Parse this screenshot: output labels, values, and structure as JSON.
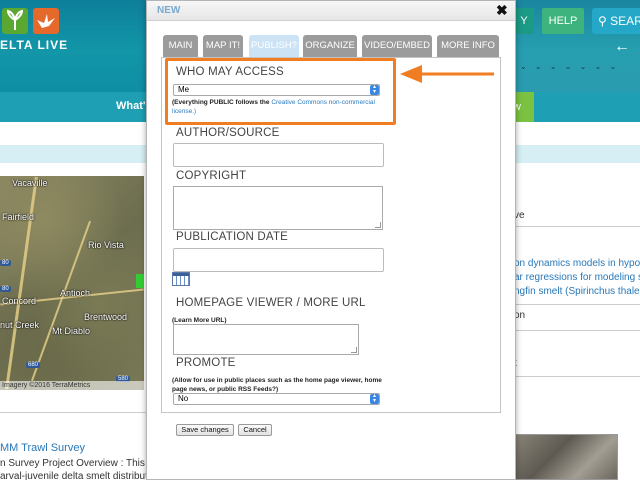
{
  "background": {
    "logo_text": "ELTA LIVE",
    "header_buttons": {
      "y_label": "Y",
      "help_label": "HELP",
      "search_label": "SEAR"
    },
    "back_arrow_glyph": "←",
    "nav_whats": "What's",
    "nav_green_label": "w",
    "map": {
      "labels": [
        "Vacaville",
        "Fairfield",
        "Rio Vista",
        "Concord",
        "Antioch",
        "Brentwood",
        "nut Creek",
        "Mt Diablo"
      ],
      "shields": [
        "80",
        "80",
        "680",
        "580"
      ],
      "credit": "Imagery ©2016 TerraMetrics"
    },
    "right_snippets": [
      "ve",
      "on dynamics models in hypothe",
      "ar regressions for modeling su",
      "ngfin smelt (Spirinchus thaleic",
      "on",
      "t"
    ],
    "bottom": {
      "link": "MM Trawl Survey",
      "line1": "n Survey Project Overview : This",
      "line2": "arval-juvenile delta smelt distributi"
    }
  },
  "modal": {
    "title": "NEW",
    "close_glyph": "✖",
    "tabs": [
      "MAIN",
      "MAP IT!",
      "PUBLISH?",
      "ORGANIZE",
      "VIDEO/EMBED",
      "MORE INFO"
    ],
    "active_tab": "PUBLISH?",
    "who_may_access": {
      "label": "WHO MAY ACCESS",
      "value": "Me",
      "hint_prefix": "(Everything PUBLIC follows the ",
      "hint_link": "Creative Commons non-commercial",
      "hint_suffix": "license.)"
    },
    "author_label": "AUTHOR/SOURCE",
    "copyright_label": "COPYRIGHT",
    "publication_date_label": "PUBLICATION DATE",
    "homepage_label": "HOMEPAGE VIEWER / MORE URL",
    "homepage_hint": "(Learn More URL)",
    "promote": {
      "label": "PROMOTE",
      "hint": "(Allow for use in public places such as the home page viewer, home page news, or public RSS Feeds?)",
      "value": "No"
    },
    "buttons": {
      "save": "Save changes",
      "cancel": "Cancel"
    }
  },
  "colors": {
    "highlight": "#f17d22",
    "active_tab": "#cce3f6",
    "inactive_tab": "#9b9b9b",
    "header_teal": "#0e7f9a"
  },
  "icons": [
    "close-icon",
    "calendar-icon",
    "select-arrows-icon",
    "arrow-left-icon",
    "search-icon"
  ]
}
